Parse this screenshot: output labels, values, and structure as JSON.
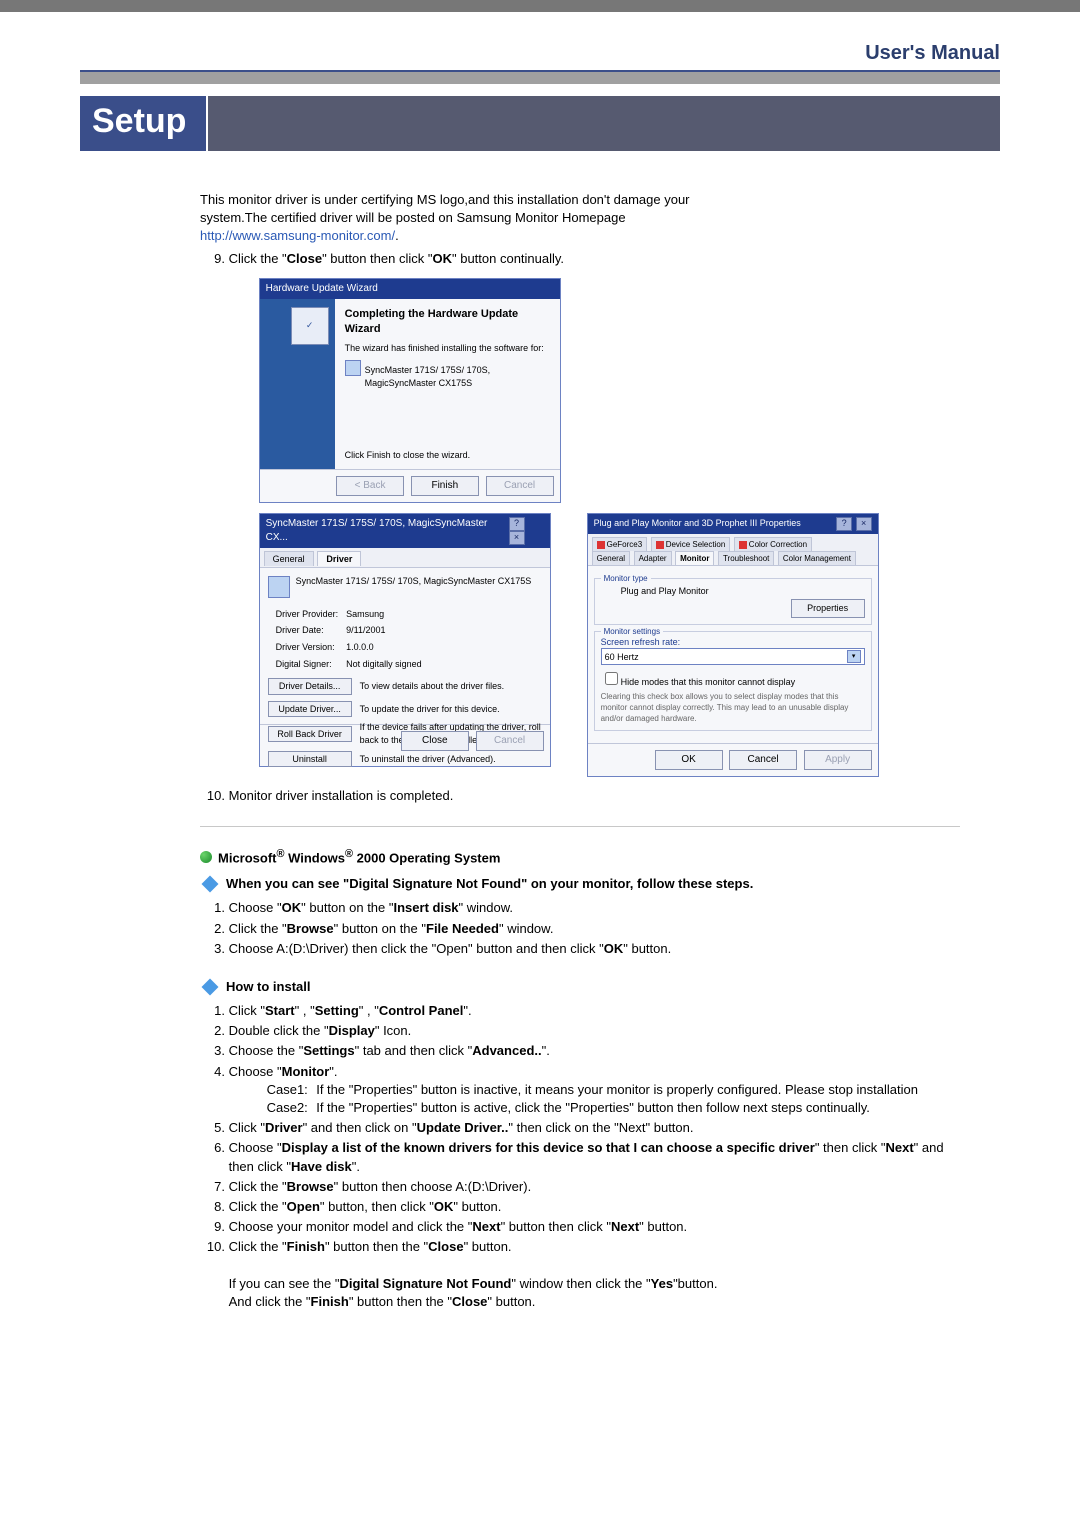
{
  "header": {
    "users_manual": "User's Manual"
  },
  "setup": {
    "title": "Setup"
  },
  "intro": {
    "line1": "This monitor driver is under certifying MS logo,and this installation don't damage your",
    "line2": "system.The certified driver will be posted on Samsung Monitor Homepage",
    "url": "http://www.samsung-monitor.com/",
    "step9_prefix": "Click the \"",
    "step9_close": "Close",
    "step9_mid": "\" button then click \"",
    "step9_ok": "OK",
    "step9_suffix": "\" button continually."
  },
  "wizard": {
    "title": "Hardware Update Wizard",
    "heading": "Completing the Hardware Update Wizard",
    "sub": "The wizard has finished installing the software for:",
    "device": "SyncMaster 171S/ 175S/ 170S, MagicSyncMaster CX175S",
    "hint": "Click Finish to close the wizard.",
    "back": "< Back",
    "finish": "Finish",
    "cancel": "Cancel"
  },
  "props": {
    "title": "SyncMaster 171S/ 175S/ 170S, MagicSyncMaster CX...",
    "tab_general": "General",
    "tab_driver": "Driver",
    "device": "SyncMaster 171S/ 175S/ 170S, MagicSyncMaster CX175S",
    "row_provider_k": "Driver Provider:",
    "row_provider_v": "Samsung",
    "row_date_k": "Driver Date:",
    "row_date_v": "9/11/2001",
    "row_version_k": "Driver Version:",
    "row_version_v": "1.0.0.0",
    "row_signer_k": "Digital Signer:",
    "row_signer_v": "Not digitally signed",
    "btn_details": "Driver Details...",
    "btn_details_d": "To view details about the driver files.",
    "btn_update": "Update Driver...",
    "btn_update_d": "To update the driver for this device.",
    "btn_rollback": "Roll Back Driver",
    "btn_rollback_d": "If the device fails after updating the driver, roll back to the previously installed driver.",
    "btn_uninstall": "Uninstall",
    "btn_uninstall_d": "To uninstall the driver (Advanced).",
    "close": "Close",
    "cancel": "Cancel"
  },
  "pnp": {
    "title": "Plug and Play Monitor and 3D Prophet III Properties",
    "tabs_top1": "GeForce3",
    "tabs_top2": "Device Selection",
    "tabs_top3": "Color Correction",
    "tabs_bot_general": "General",
    "tabs_bot_adapter": "Adapter",
    "tabs_bot_monitor": "Monitor",
    "tabs_bot_trouble": "Troubleshoot",
    "tabs_bot_color": "Color Management",
    "legend_type": "Monitor type",
    "device": "Plug and Play Monitor",
    "properties": "Properties",
    "legend_settings": "Monitor settings",
    "refresh_label": "Screen refresh rate:",
    "refresh_value": "60 Hertz",
    "hide_modes": "Hide modes that this monitor cannot display",
    "hide_modes_hint": "Clearing this check box allows you to select display modes that this monitor cannot display correctly. This may lead to an unusable display and/or damaged hardware.",
    "ok": "OK",
    "cancel": "Cancel",
    "apply": "Apply"
  },
  "step10": "Monitor driver installation is completed.",
  "os2000": {
    "title_a": "Microsoft",
    "title_b": " Windows",
    "title_c": " 2000 Operating System",
    "sig_head": "When you can see \"Digital Signature Not Found\" on your monitor, follow these steps.",
    "s1a": "Choose \"",
    "s1b": "OK",
    "s1c": "\" button on the \"",
    "s1d": "Insert disk",
    "s1e": "\" window.",
    "s2a": "Click the \"",
    "s2b": "Browse",
    "s2c": "\" button on the \"",
    "s2d": "File Needed",
    "s2e": "\" window.",
    "s3a": "Choose A:(D:\\Driver) then click the \"Open\" button and then click \"",
    "s3b": "OK",
    "s3c": "\" button.",
    "how_head": "How to install",
    "h1a": "Click \"",
    "h1b": "Start",
    "h1c": "\" , \"",
    "h1d": "Setting",
    "h1e": "\" , \"",
    "h1f": "Control Panel",
    "h1g": "\".",
    "h2a": "Double click the \"",
    "h2b": "Display",
    "h2c": "\" Icon.",
    "h3a": "Choose the \"",
    "h3b": "Settings",
    "h3c": "\" tab and then click \"",
    "h3d": "Advanced..",
    "h3e": "\".",
    "h4a": "Choose \"",
    "h4b": "Monitor",
    "h4c": "\".",
    "case1_l": "Case1:",
    "case1_t": "If the \"Properties\" button is inactive, it means your monitor is properly configured. Please stop installation",
    "case2_l": "Case2:",
    "case2_t": "If the \"Properties\" button is active, click the \"Properties\" button then follow next steps continually.",
    "h5a": "Click \"",
    "h5b": "Driver",
    "h5c": "\" and then click on \"",
    "h5d": "Update Driver..",
    "h5e": "\" then click on the \"Next\" button.",
    "h6a": "Choose \"",
    "h6b": "Display a list of the known drivers for this device so that I can choose a specific driver",
    "h6c": "\" then click \"",
    "h6d": "Next",
    "h6e": "\" and then click \"",
    "h6f": "Have disk",
    "h6g": "\".",
    "h7a": "Click the \"",
    "h7b": "Browse",
    "h7c": "\" button then choose A:(D:\\Driver).",
    "h8a": "Click the \"",
    "h8b": "Open",
    "h8c": "\" button, then click \"",
    "h8d": "OK",
    "h8e": "\" button.",
    "h9a": "Choose your monitor model and click the \"",
    "h9b": "Next",
    "h9c": "\" button then click \"",
    "h9d": "Next",
    "h9e": "\" button.",
    "h10a": "Click the \"",
    "h10b": "Finish",
    "h10c": "\" button then the \"",
    "h10d": "Close",
    "h10e": "\" button.",
    "foot1a": "If you can see the \"",
    "foot1b": "Digital Signature Not Found",
    "foot1c": "\" window then click the \"",
    "foot1d": "Yes",
    "foot1e": "\"button.",
    "foot2a": "And click the \"",
    "foot2b": "Finish",
    "foot2c": "\" button then the \"",
    "foot2d": "Close",
    "foot2e": "\" button."
  }
}
